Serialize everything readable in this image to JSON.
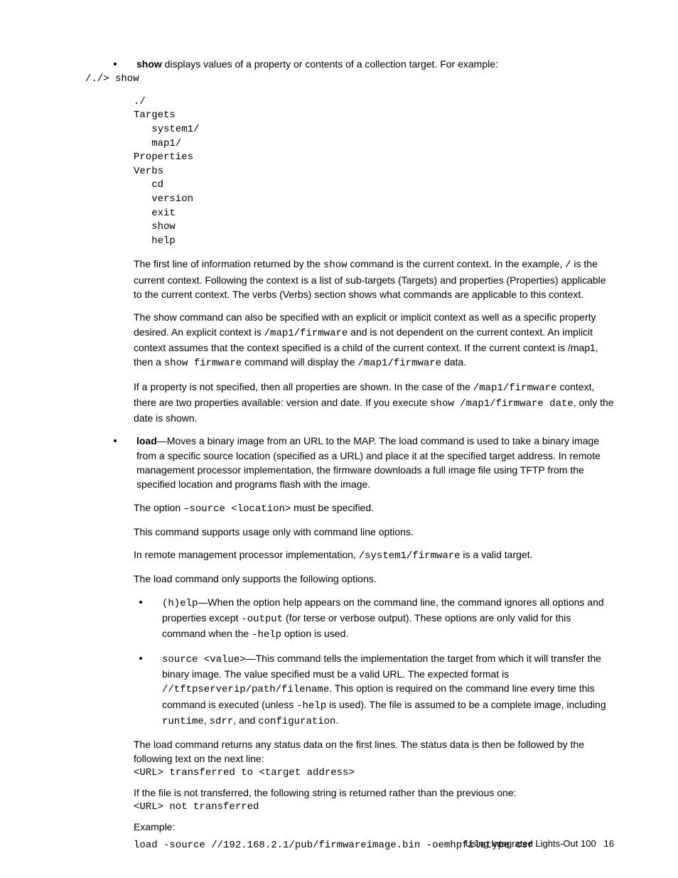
{
  "item_show": {
    "bold": "show",
    "desc": " displays values of a property or contents of a collection target. For example:"
  },
  "code_prompt": "/./> show",
  "code_output": "./\nTargets\n   system1/\n   map1/\nProperties\nVerbs\n   cd\n   version\n   exit\n   show\n   help",
  "para_show1_a": "The first line of information returned by the ",
  "para_show1_cmd": "show",
  "para_show1_b": " command is the current context. In the example, ",
  "para_show1_slash": "/",
  "para_show1_c": " is the current context. Following the context is a list of sub-targets (Targets) and properties (Properties) applicable to the current context. The verbs (Verbs) section shows what commands are applicable to this context.",
  "para_show2_a": "The show command can also be specified with an explicit or implicit context as well as a specific property desired. An explicit context is ",
  "para_show2_path1": "/map1/firmware",
  "para_show2_b": " and is not dependent on the current context. An implicit context assumes that the context specified is a child of the current context. If the current context is /map1, then a ",
  "para_show2_cmd": "show firmware",
  "para_show2_c": " command will display the ",
  "para_show2_path2": "/map1/firmware",
  "para_show2_d": " data.",
  "para_show3_a": "If a property is not specified, then all properties are shown. In the case of the ",
  "para_show3_path1": "/map1/firmware",
  "para_show3_b": " context, there are two properties available: version and date. If you execute ",
  "para_show3_cmd": "show /map1/firmware date",
  "para_show3_c": ", only the date is shown.",
  "item_load": {
    "bold": "load",
    "desc": "—Moves a binary image from an URL to the MAP. The load command is used to take a binary image from a specific source location (specified as a URL) and place it at the specified target address. In remote management processor implementation, the firmware downloads a full image file using TFTP from the specified location and programs flash with the image."
  },
  "para_load1_a": "The option ",
  "para_load1_opt": "–source <location>",
  "para_load1_b": " must be specified.",
  "para_load2": "This command supports usage only with command line options.",
  "para_load3_a": "In remote management processor implementation, ",
  "para_load3_path": "/system1/firmware",
  "para_load3_b": " is a valid target.",
  "para_load4": "The load command only supports the following options.",
  "sub_help_cmd": "(h)elp",
  "sub_help_a": "—When the option help appears on the command line, the command ignores all options and properties except ",
  "sub_help_out": "-output",
  "sub_help_b": " (for terse or verbose output). These options are only valid for this command when the ",
  "sub_help_hflag": "-help",
  "sub_help_c": " option is used.",
  "sub_source_cmd": "source <value>",
  "sub_source_a": "—This command tells the implementation the target from which it will transfer the binary image. The value specified must be a valid URL. The expected format is ",
  "sub_source_url": "//tftpserverip/path/filename",
  "sub_source_b": ". This option is required on the command line every time this command is executed (unless ",
  "sub_source_hflag": "-help",
  "sub_source_c": " is used). The file is assumed to be a complete image, including ",
  "sub_source_rt": "runtime",
  "sub_source_comma1": ", ",
  "sub_source_sd": "sdrr",
  "sub_source_and": ", and ",
  "sub_source_cfg": "configuration",
  "sub_source_dot": ".",
  "para_load5": "The load command returns any status data on the first lines. The status data is then be followed by the following text on the next line:",
  "code_transferred": "<URL> transferred to <target address>",
  "para_load6": "If the file is not transferred, the following string is returned rather than the previous one:",
  "code_nottransferred": "<URL> not transferred",
  "para_example": "Example:",
  "code_example": "load -source //192.168.2.1/pub/firmwareimage.bin -oemhpfiletype csr",
  "footer_text": "Using Integrated Lights-Out 100",
  "footer_page": "16"
}
